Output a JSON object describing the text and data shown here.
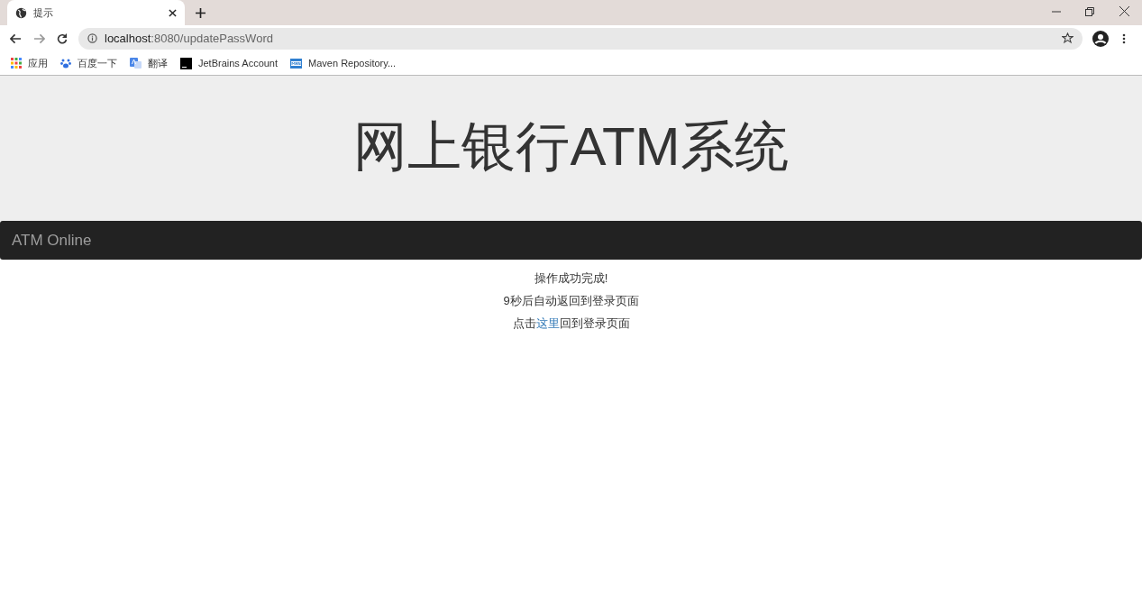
{
  "browser": {
    "tab": {
      "title": "提示",
      "selected": true
    },
    "address": {
      "host": "localhost",
      "path": ":8080/updatePassWord"
    },
    "bookmarks": [
      {
        "label": "应用",
        "kind": "apps"
      },
      {
        "label": "百度一下",
        "kind": "paw"
      },
      {
        "label": "翻译",
        "kind": "translate"
      },
      {
        "label": "JetBrains Account",
        "kind": "jb"
      },
      {
        "label": "Maven Repository...",
        "kind": "mvn"
      }
    ]
  },
  "page": {
    "header_title": "网上银行ATM系统",
    "navbar_brand": "ATM Online",
    "messages": [
      "操作成功完成!",
      "9秒后自动返回到登录页面"
    ],
    "link_line": {
      "before": "点击",
      "link": "这里",
      "after": "回到登录页面"
    }
  }
}
